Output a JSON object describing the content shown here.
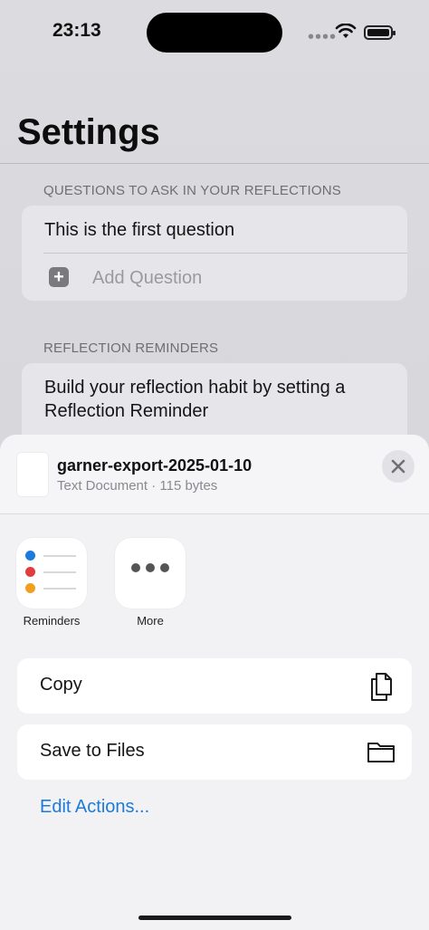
{
  "status_bar": {
    "time": "23:13"
  },
  "settings": {
    "title": "Settings",
    "questions_header": "QUESTIONS TO ASK IN YOUR REFLECTIONS",
    "first_question": "This is the first question",
    "add_question": "Add Question",
    "reminders_header": "REFLECTION REMINDERS",
    "reminder_text_line1": "Build your reflection habit by setting a",
    "reminder_text_line2": "Reflection Reminder"
  },
  "share_sheet": {
    "file_name": "garner-export-2025-01-10",
    "file_meta": "Text Document · 115 bytes",
    "apps": [
      {
        "label": "Reminders",
        "icon": "reminders-icon"
      },
      {
        "label": "More",
        "icon": "more-icon"
      }
    ],
    "reminder_dot_colors": [
      "#1a7ae0",
      "#e23d3d",
      "#f0a020"
    ],
    "actions": [
      {
        "label": "Copy",
        "icon": "copy-icon"
      },
      {
        "label": "Save to Files",
        "icon": "folder-icon"
      }
    ],
    "edit_actions": "Edit Actions...",
    "accent_color": "#1c7ad8"
  }
}
